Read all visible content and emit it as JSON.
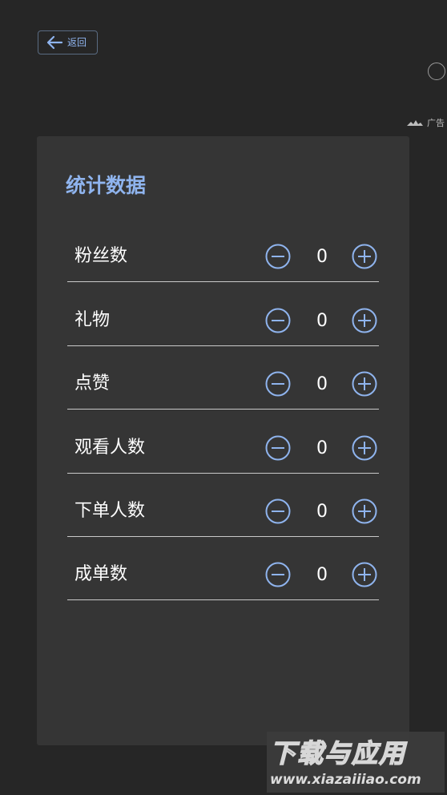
{
  "header": {
    "back_label": "返回"
  },
  "ad": {
    "label": "广告"
  },
  "panel": {
    "title": "统计数据",
    "rows": [
      {
        "label": "粉丝数",
        "value": "0"
      },
      {
        "label": "礼物",
        "value": "0"
      },
      {
        "label": "点赞",
        "value": "0"
      },
      {
        "label": "观看人数",
        "value": "0"
      },
      {
        "label": "下单人数",
        "value": "0"
      },
      {
        "label": "成单数",
        "value": "0"
      }
    ]
  },
  "watermark": {
    "main": "下载与应用",
    "url": "www.xiazaiiiao.com"
  },
  "colors": {
    "background": "#262626",
    "panel": "#353535",
    "accent": "#8fb4ee",
    "text": "#ffffff",
    "divider": "#c9c9c9"
  },
  "icons": {
    "back": "arrow-left-icon",
    "decrement": "minus-circle-icon",
    "increment": "plus-circle-icon",
    "ad_logo": "ad-logo-icon"
  }
}
